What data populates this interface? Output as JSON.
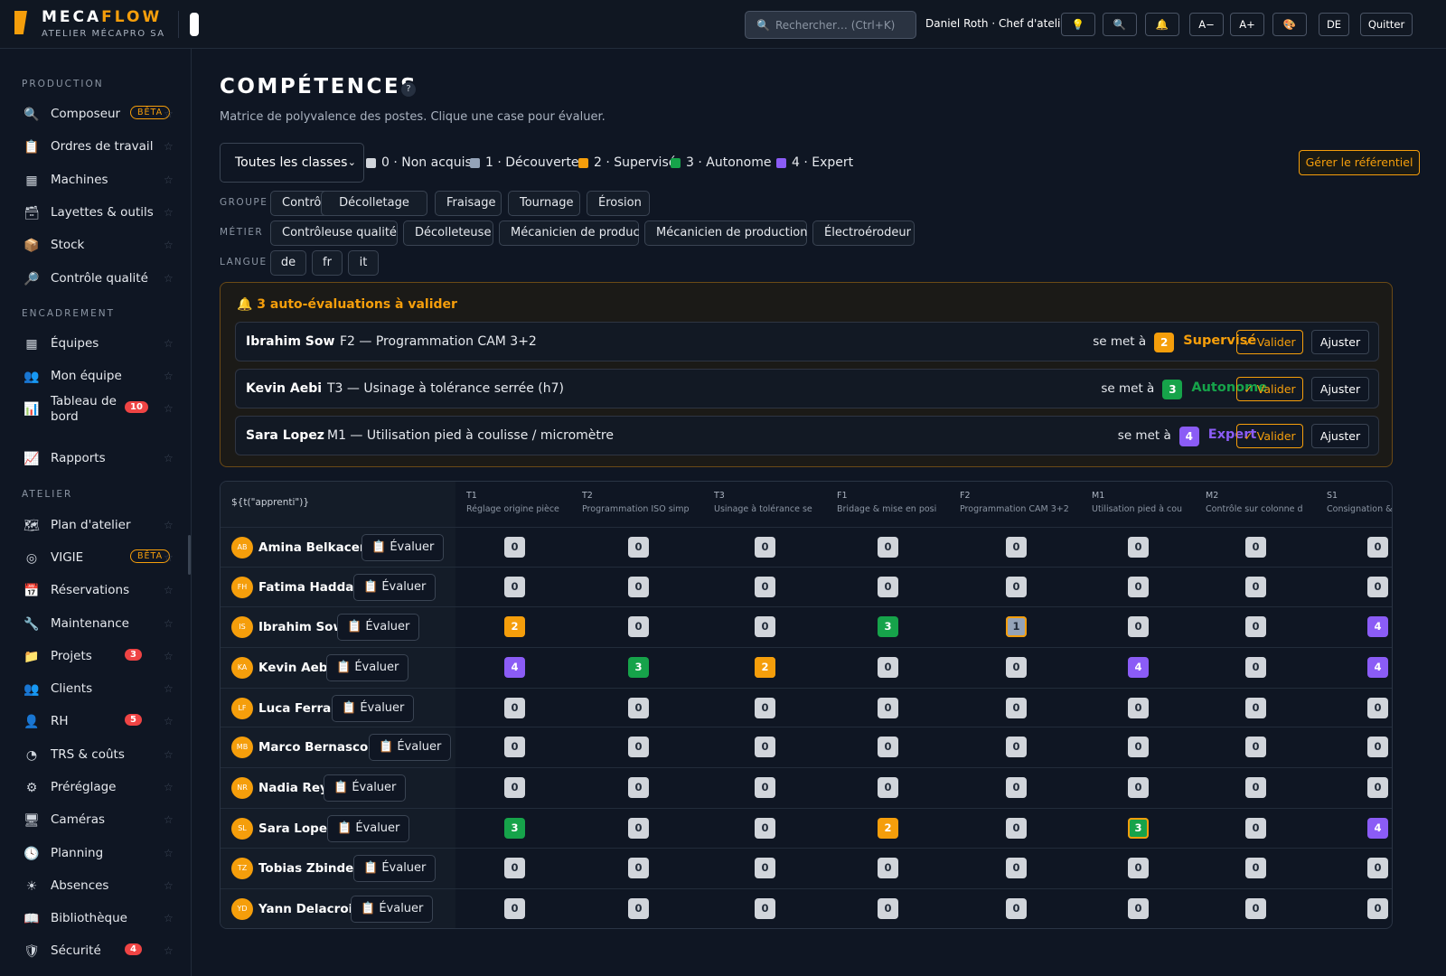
{
  "topbar": {
    "brand_a": "MECA",
    "brand_b": "FLOW",
    "company": "ATELIER MÉCAPRO SA",
    "search_placeholder": "Rechercher… (Ctrl+K)",
    "user": "Daniel Roth · Chef d'atelier",
    "buttons": [
      {
        "name": "tip-button",
        "label": "💡"
      },
      {
        "name": "search-button",
        "label": "🔍"
      },
      {
        "name": "notifications-button",
        "label": "🔔"
      },
      {
        "name": "font-decrease-button",
        "label": "A−"
      },
      {
        "name": "font-increase-button",
        "label": "A+"
      },
      {
        "name": "theme-button",
        "label": "🎨"
      },
      {
        "name": "language-button",
        "label": "DE"
      },
      {
        "name": "quit-button",
        "label": "Quitter"
      }
    ]
  },
  "sidebar": {
    "sections": [
      {
        "label": "PRODUCTION"
      },
      {
        "label": "ENCADREMENT"
      },
      {
        "label": "ATELIER"
      }
    ],
    "items": [
      {
        "label": "Composeur",
        "icon": "🔍",
        "beta": "BÊTA"
      },
      {
        "label": "Ordres de travail",
        "icon": "📋"
      },
      {
        "label": "Machines",
        "icon": "▦"
      },
      {
        "label": "Layettes & outils",
        "icon": "🗃"
      },
      {
        "label": "Stock",
        "icon": "📦"
      },
      {
        "label": "Contrôle qualité",
        "icon": "🔎"
      },
      {
        "label": "Équipes",
        "icon": "▦"
      },
      {
        "label": "Mon équipe",
        "icon": "👥"
      },
      {
        "label": "Tableau de bord",
        "icon": "📊",
        "badge": "10"
      },
      {
        "label": "Rapports",
        "icon": "📈"
      },
      {
        "label": "Plan d'atelier",
        "icon": "🗺"
      },
      {
        "label": "VIGIE",
        "icon": "◎",
        "beta": "BÊTA"
      },
      {
        "label": "Réservations",
        "icon": "📅"
      },
      {
        "label": "Maintenance",
        "icon": "🔧"
      },
      {
        "label": "Projets",
        "icon": "📁",
        "badge": "3"
      },
      {
        "label": "Clients",
        "icon": "👥"
      },
      {
        "label": "RH",
        "icon": "👤",
        "badge": "5"
      },
      {
        "label": "TRS & coûts",
        "icon": "◔"
      },
      {
        "label": "Préréglage",
        "icon": "⚙"
      },
      {
        "label": "Caméras",
        "icon": "🖥"
      },
      {
        "label": "Planning",
        "icon": "🕓"
      },
      {
        "label": "Absences",
        "icon": "☀"
      },
      {
        "label": "Bibliothèque",
        "icon": "📖"
      },
      {
        "label": "Sécurité",
        "icon": "🛡",
        "badge": "4"
      }
    ]
  },
  "page": {
    "title": "COMPÉTENCES",
    "help": "?",
    "subtitle": "Matrice de polyvalence des postes. Clique une case pour évaluer.",
    "class_select": "Toutes les classes",
    "manage_button": "Gérer le référentiel",
    "legend": [
      {
        "label": "0 · Non acquis",
        "color": "#d1d5db"
      },
      {
        "label": "1 · Découverte",
        "color": "#94a3b8"
      },
      {
        "label": "2 · Supervisé",
        "color": "#f59e0b"
      },
      {
        "label": "3 · Autonome",
        "color": "#16a34a"
      },
      {
        "label": "4 · Expert",
        "color": "#8b5cf6"
      }
    ]
  },
  "filters": {
    "groupe_label": "GROUPE",
    "groupe": [
      "Contrôle",
      "Décolletage",
      "Fraisage",
      "Tournage",
      "Érosion"
    ],
    "metier_label": "MÉTIER",
    "metier": [
      "Contrôleuse qualité",
      "Décolleteuse",
      "Mécanicien de produc",
      "Mécanicien de production",
      "Électroérodeur"
    ],
    "langue_label": "LANGUE",
    "langue": [
      "de",
      "fr",
      "it"
    ]
  },
  "pending": {
    "title": "🔔 3 auto-évaluations à valider",
    "self_text": "se met à",
    "validate": "✓ Valider",
    "adjust": "Ajuster",
    "rows": [
      {
        "name": "Ibrahim Sow",
        "task": "F2 — Programmation CAM 3+2",
        "level": "2",
        "level_name": "Supervisé"
      },
      {
        "name": "Kevin Aebi",
        "task": "T3 — Usinage à tolérance serrée (h7)",
        "level": "3",
        "level_name": "Autonome"
      },
      {
        "name": "Sara Lopez",
        "task": "M1 — Utilisation pied à coulisse / micromètre",
        "level": "4",
        "level_name": "Expert"
      }
    ]
  },
  "matrix": {
    "corner": "${t(\"apprenti\")}",
    "evaluate": "📋 Évaluer",
    "columns": [
      {
        "code": "T1",
        "name": "Réglage origine pièce"
      },
      {
        "code": "T2",
        "name": "Programmation ISO simp"
      },
      {
        "code": "T3",
        "name": "Usinage à tolérance se"
      },
      {
        "code": "F1",
        "name": "Bridage & mise en posi"
      },
      {
        "code": "F2",
        "name": "Programmation CAM 3+2"
      },
      {
        "code": "M1",
        "name": "Utilisation pied à cou"
      },
      {
        "code": "M2",
        "name": "Contrôle sur colonne d"
      },
      {
        "code": "S1",
        "name": "Consignation &"
      }
    ],
    "rows": [
      {
        "initials": "AB",
        "name": "Amina Belkacem",
        "levels": [
          0,
          0,
          0,
          0,
          0,
          0,
          0,
          0
        ],
        "pending": []
      },
      {
        "initials": "FH",
        "name": "Fatima Haddad",
        "levels": [
          0,
          0,
          0,
          0,
          0,
          0,
          0,
          0
        ],
        "pending": []
      },
      {
        "initials": "IS",
        "name": "Ibrahim Sow",
        "levels": [
          2,
          0,
          0,
          3,
          1,
          0,
          0,
          4
        ],
        "pending": [
          4
        ]
      },
      {
        "initials": "KA",
        "name": "Kevin Aebi",
        "levels": [
          4,
          3,
          2,
          0,
          0,
          4,
          0,
          4
        ],
        "pending": [
          2
        ]
      },
      {
        "initials": "LF",
        "name": "Luca Ferrari",
        "levels": [
          0,
          0,
          0,
          0,
          0,
          0,
          0,
          0
        ],
        "pending": []
      },
      {
        "initials": "MB",
        "name": "Marco Bernasconi",
        "levels": [
          0,
          0,
          0,
          0,
          0,
          0,
          0,
          0
        ],
        "pending": []
      },
      {
        "initials": "NR",
        "name": "Nadia Rey",
        "levels": [
          0,
          0,
          0,
          0,
          0,
          0,
          0,
          0
        ],
        "pending": []
      },
      {
        "initials": "SL",
        "name": "Sara Lopez",
        "levels": [
          3,
          0,
          0,
          2,
          0,
          3,
          0,
          4
        ],
        "pending": [
          5
        ]
      },
      {
        "initials": "TZ",
        "name": "Tobias Zbinden",
        "levels": [
          0,
          0,
          0,
          0,
          0,
          0,
          0,
          0
        ],
        "pending": []
      },
      {
        "initials": "YD",
        "name": "Yann Delacroix",
        "levels": [
          0,
          0,
          0,
          0,
          0,
          0,
          0,
          0
        ],
        "pending": []
      }
    ]
  }
}
